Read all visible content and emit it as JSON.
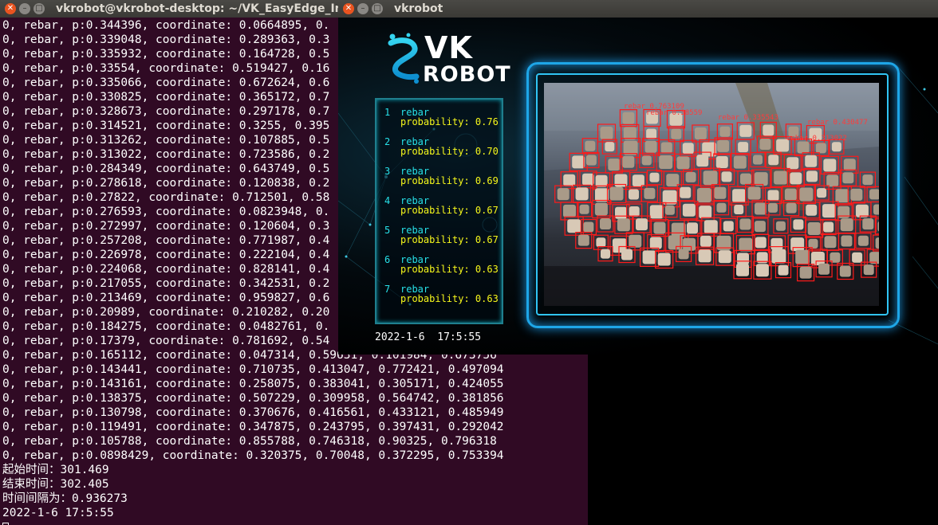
{
  "terminal": {
    "title": "vkrobot@vkrobot-desktop: ~/VK_EasyEdge_Infe",
    "lines": [
      "0, rebar, p:0.344396, coordinate: 0.0664895, 0.",
      "0, rebar, p:0.339048, coordinate: 0.289363, 0.3",
      "0, rebar, p:0.335932, coordinate: 0.164728, 0.5",
      "0, rebar, p:0.33554, coordinate: 0.519427, 0.16",
      "0, rebar, p:0.335066, coordinate: 0.672624, 0.6",
      "0, rebar, p:0.330825, coordinate: 0.365172, 0.7",
      "0, rebar, p:0.328673, coordinate: 0.297178, 0.7",
      "0, rebar, p:0.314521, coordinate: 0.3255, 0.395",
      "0, rebar, p:0.313262, coordinate: 0.107885, 0.5",
      "0, rebar, p:0.313022, coordinate: 0.723586, 0.2",
      "0, rebar, p:0.284349, coordinate: 0.643749, 0.5",
      "0, rebar, p:0.278618, coordinate: 0.120838, 0.2",
      "0, rebar, p:0.27822, coordinate: 0.712501, 0.58",
      "0, rebar, p:0.276593, coordinate: 0.0823948, 0.",
      "0, rebar, p:0.272997, coordinate: 0.120604, 0.3",
      "0, rebar, p:0.257208, coordinate: 0.771987, 0.4",
      "0, rebar, p:0.226978, coordinate: 0.222104, 0.4",
      "0, rebar, p:0.224068, coordinate: 0.828141, 0.4",
      "0, rebar, p:0.217055, coordinate: 0.342531, 0.2",
      "0, rebar, p:0.213469, coordinate: 0.959827, 0.6",
      "0, rebar, p:0.20989, coordinate: 0.210282, 0.20",
      "0, rebar, p:0.184275, coordinate: 0.0482761, 0.",
      "0, rebar, p:0.17379, coordinate: 0.781692, 0.54",
      "0, rebar, p:0.165112, coordinate: 0.047314, 0.59631, 0.101984, 0.673756",
      "0, rebar, p:0.143441, coordinate: 0.710735, 0.413047, 0.772421, 0.497094",
      "0, rebar, p:0.143161, coordinate: 0.258075, 0.383041, 0.305171, 0.424055",
      "0, rebar, p:0.138375, coordinate: 0.507229, 0.309958, 0.564742, 0.381856",
      "0, rebar, p:0.130798, coordinate: 0.370676, 0.416561, 0.433121, 0.485949",
      "0, rebar, p:0.119491, coordinate: 0.347875, 0.243795, 0.397431, 0.292042",
      "0, rebar, p:0.105788, coordinate: 0.855788, 0.746318, 0.90325, 0.796318",
      "0, rebar, p:0.0898429, coordinate: 0.320375, 0.70048, 0.372295, 0.753394",
      "起始时间：301.469",
      "结束时间：302.405",
      "时间间隔为：0.936273",
      "2022-1-6 17:5:55"
    ]
  },
  "vk_window": {
    "title": "vkrobot",
    "logo_top": "VK",
    "logo_bottom": "ROBOT",
    "items": [
      {
        "num": "1",
        "label": "rebar",
        "prob": "probability: 0.76"
      },
      {
        "num": "2",
        "label": "rebar",
        "prob": "probability: 0.70"
      },
      {
        "num": "3",
        "label": "rebar",
        "prob": "probability: 0.69"
      },
      {
        "num": "4",
        "label": "rebar",
        "prob": "probability: 0.67"
      },
      {
        "num": "5",
        "label": "rebar",
        "prob": "probability: 0.67"
      },
      {
        "num": "6",
        "label": "rebar",
        "prob": "probability: 0.63"
      },
      {
        "num": "7",
        "label": "rebar",
        "prob": "probability: 0.63"
      }
    ],
    "datetime": "2022-1-6  17:5:55",
    "detection_labels": [
      "rebar 0.763109",
      "rebar 0.335543",
      "rebar 0.430477",
      "rebar 0.313022",
      "rebar 0.38559"
    ],
    "colors": {
      "accent": "#1ea6e8",
      "label": "#27e1e9",
      "prob": "#f6f81b",
      "box": "#ff1a1a",
      "terminal_bg": "#300a24"
    }
  }
}
